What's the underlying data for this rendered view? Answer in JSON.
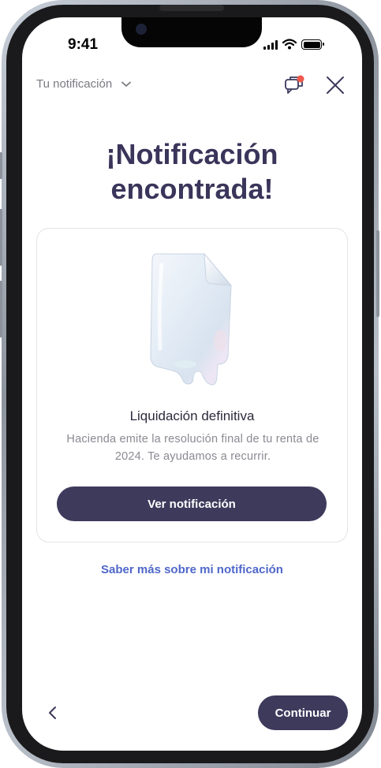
{
  "status_bar": {
    "time": "9:41"
  },
  "header": {
    "dropdown_label": "Tu notificación",
    "has_new_message": true
  },
  "title": {
    "line1": "¡Notificación",
    "line2": "encontrada!"
  },
  "card": {
    "title": "Liquidación definitiva",
    "description": "Hacienda emite la resolución final de tu renta de 2024. Te ayudamos a recurrir.",
    "button_label": "Ver notificación"
  },
  "link_label": "Saber más sobre mi notificación",
  "footer": {
    "continue_label": "Continuar"
  },
  "colors": {
    "primary": "#3d3a5c",
    "link": "#4f67c9",
    "badge": "#ef5a4d"
  },
  "icons": {
    "chat": "chat-bubbles-icon",
    "close": "close-icon",
    "dropdown": "chevron-down-icon",
    "back": "chevron-left-icon"
  }
}
